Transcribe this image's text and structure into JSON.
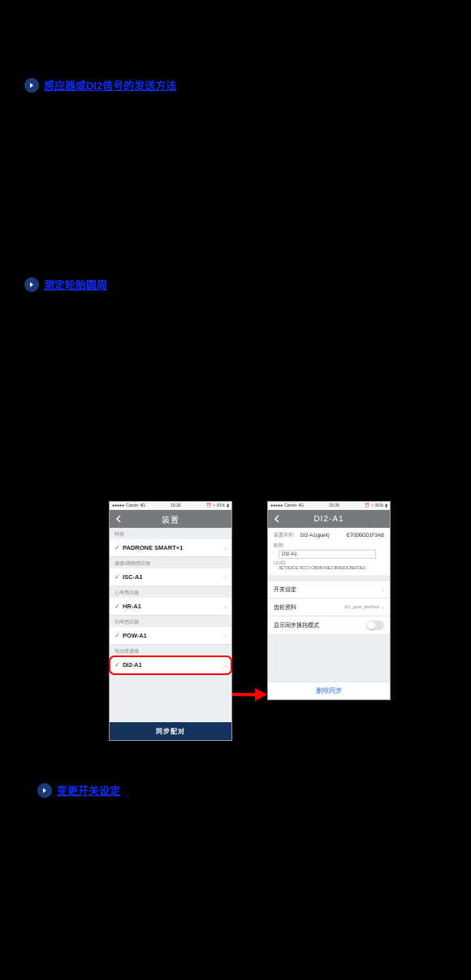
{
  "links": {
    "sensor_signal": "感应器或DI2信号的发送方法",
    "tire": "测定轮胎圆周",
    "switch": "变更开关设定"
  },
  "statusbar": {
    "carrier": "Carrier",
    "network": "4G",
    "time": "15:26",
    "battery": "81%"
  },
  "left": {
    "title": "装置",
    "sections": {
      "meter": "码表",
      "meter_item": "PADRONE SMART+1",
      "spdcad": "速度•踏频感应器",
      "spdcad_item": "ISC-A1",
      "hr": "心率感应器",
      "hr_item": "HR-A1",
      "pwr": "功率感应器",
      "pwr_item": "POW-A1",
      "egear": "电动变速器",
      "egear_item": "DI2-A1"
    },
    "sync_btn": "同步配对"
  },
  "right": {
    "title": "DI2-A1",
    "device_name_label": "装置名称：",
    "device_name_value": "DI2-A1(giant)",
    "device_id": "E70DBDD1F3AB",
    "nickname_label": "昵称",
    "nickname_value": "DI2-A1",
    "uuid_label": "UUID",
    "uuid_value": "3E7262CE-9CC1-CBD8-03E2-B053DCBEFDE3",
    "switch": "开关设定",
    "gear": "齿轮资料",
    "gear_sub": "di2_gear_toothed",
    "sync_mode": "显示同步换挡模式",
    "remove": "删除同步"
  }
}
